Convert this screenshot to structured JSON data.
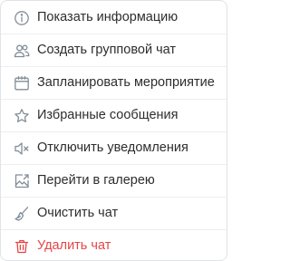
{
  "menu": {
    "items": [
      {
        "label": "Показать информацию",
        "icon": "info-icon"
      },
      {
        "label": "Создать групповой чат",
        "icon": "users-icon"
      },
      {
        "label": "Запланировать мероприятие",
        "icon": "calendar-icon"
      },
      {
        "label": "Избранные сообщения",
        "icon": "star-icon"
      },
      {
        "label": "Отключить уведомления",
        "icon": "sound-off-icon"
      },
      {
        "label": "Перейти в галерею",
        "icon": "gallery-icon"
      },
      {
        "label": "Очистить чат",
        "icon": "broom-icon"
      },
      {
        "label": "Удалить чат",
        "icon": "trash-icon"
      }
    ]
  },
  "colors": {
    "icon": "#818c99",
    "text": "#2c2d2e",
    "danger": "#e64646",
    "border": "#e1e3e6"
  }
}
